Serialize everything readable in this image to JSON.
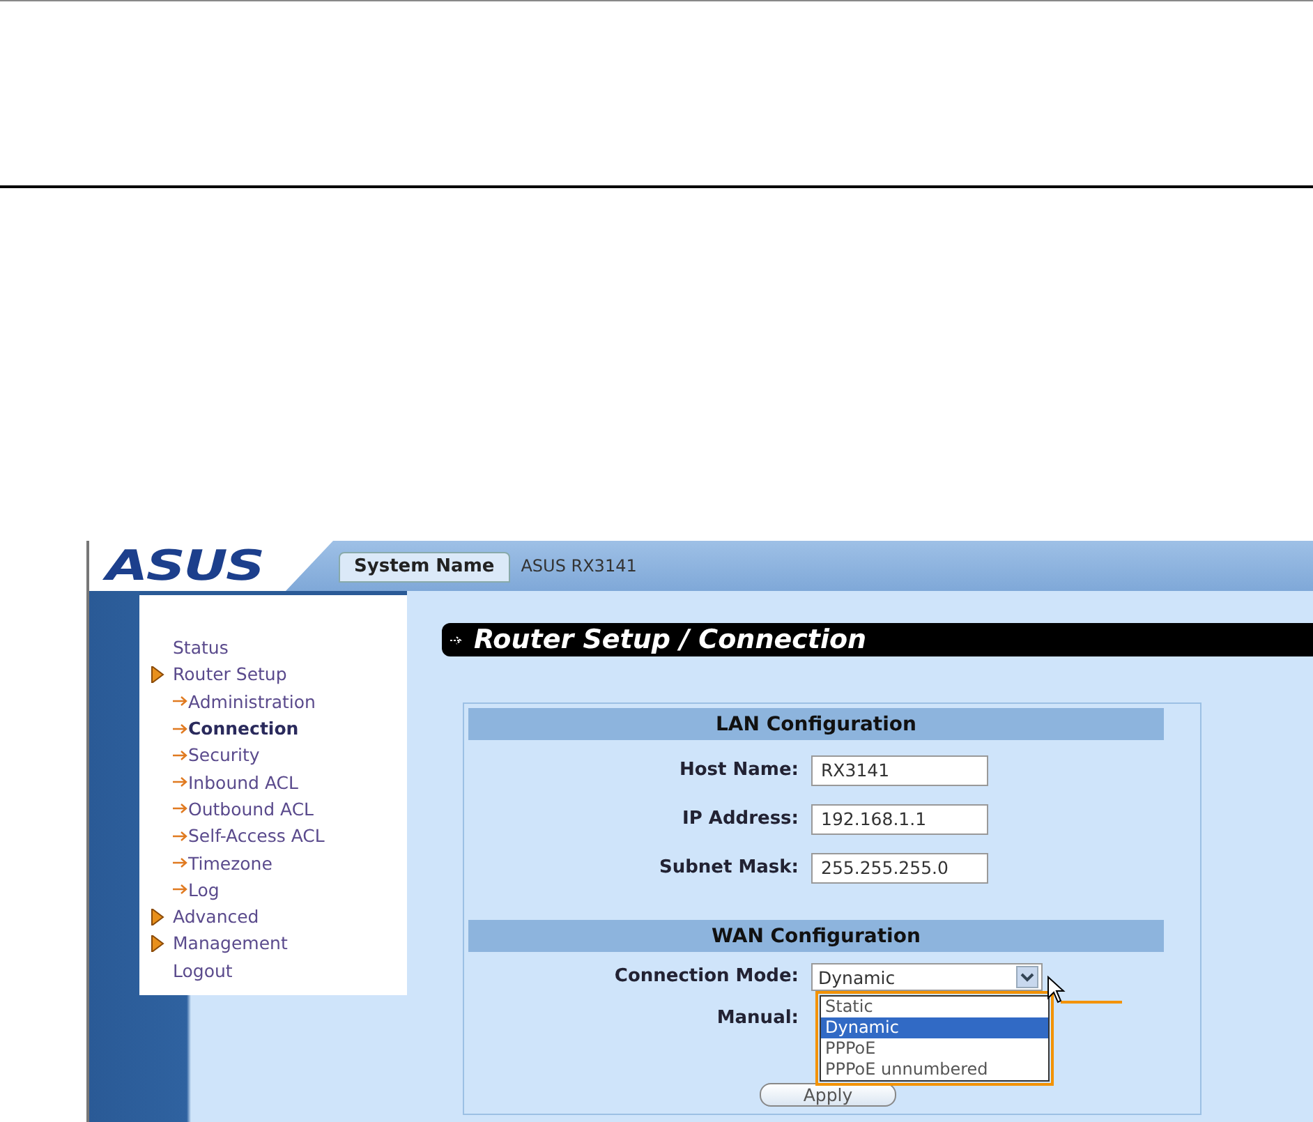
{
  "header": {
    "logo": "ASUS",
    "system_name_label": "System Name",
    "system_name": "ASUS RX3141"
  },
  "sidebar": {
    "items": [
      {
        "label": "Status",
        "kind": "plain",
        "selected": false
      },
      {
        "label": "Router Setup",
        "kind": "section",
        "selected": false
      },
      {
        "label": "Administration",
        "kind": "sub",
        "selected": false
      },
      {
        "label": "Connection",
        "kind": "sub",
        "selected": true
      },
      {
        "label": "Security",
        "kind": "sub",
        "selected": false
      },
      {
        "label": "Inbound ACL",
        "kind": "sub",
        "selected": false
      },
      {
        "label": "Outbound ACL",
        "kind": "sub",
        "selected": false
      },
      {
        "label": "Self-Access ACL",
        "kind": "sub",
        "selected": false
      },
      {
        "label": "Timezone",
        "kind": "sub",
        "selected": false
      },
      {
        "label": "Log",
        "kind": "sub",
        "selected": false
      },
      {
        "label": "Advanced",
        "kind": "section",
        "selected": false
      },
      {
        "label": "Management",
        "kind": "section",
        "selected": false
      },
      {
        "label": "Logout",
        "kind": "plain",
        "selected": false
      }
    ]
  },
  "page_title": "Router Setup / Connection",
  "lan": {
    "title": "LAN Configuration",
    "fields": [
      {
        "label": "Host Name:",
        "value": "RX3141"
      },
      {
        "label": "IP Address:",
        "value": "192.168.1.1"
      },
      {
        "label": "Subnet Mask:",
        "value": "255.255.255.0"
      }
    ]
  },
  "wan": {
    "title": "WAN Configuration",
    "connection_mode": {
      "label": "Connection Mode:",
      "value": "Dynamic",
      "expanded": true,
      "options": [
        {
          "label": "Static",
          "selected": false
        },
        {
          "label": "Dynamic",
          "selected": true
        },
        {
          "label": "PPPoE",
          "selected": false
        },
        {
          "label": "PPPoE unnumbered",
          "selected": false
        }
      ]
    },
    "manual": {
      "label": "Manual:"
    }
  },
  "apply_button": "Apply"
}
